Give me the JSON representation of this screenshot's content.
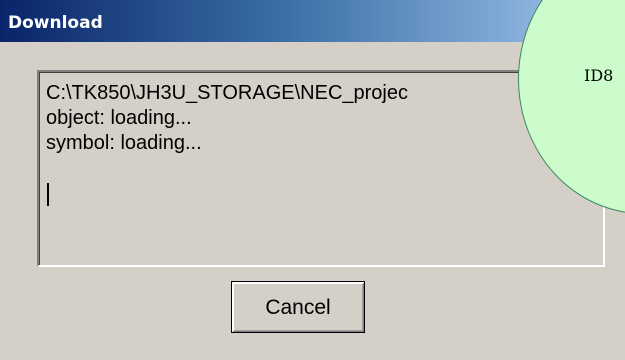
{
  "window": {
    "title": "Download"
  },
  "log": {
    "lines": [
      "C:\\TK850\\JH3U_STORAGE\\NEC_projec",
      "object: loading...",
      "symbol: loading..."
    ]
  },
  "buttons": {
    "cancel_label": "Cancel"
  },
  "overlay": {
    "label": "ID8"
  },
  "colors": {
    "titlebar_start": "#0a246a",
    "titlebar_end": "#a6caf0",
    "dialog_face": "#d4d0c8",
    "overlay_fill": "#ccfccc",
    "overlay_border": "#3a8a5a"
  }
}
